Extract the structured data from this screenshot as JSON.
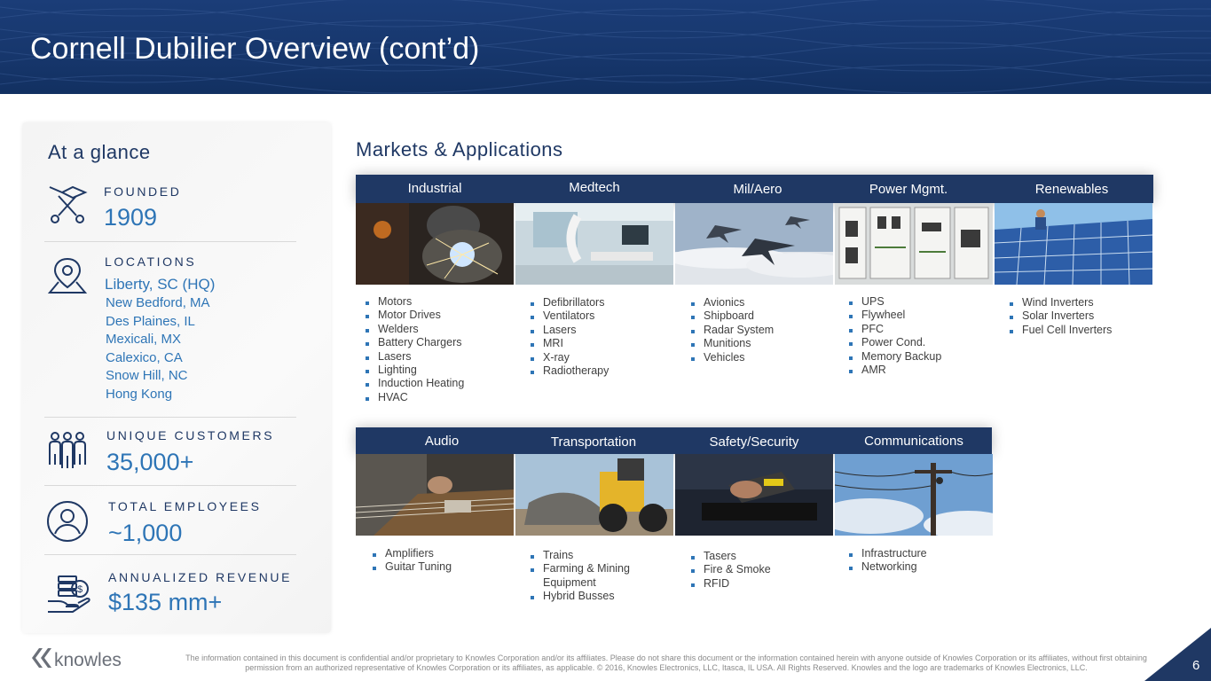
{
  "title": "Cornell Dubilier Overview (cont’d)",
  "glance": {
    "title": "At a glance",
    "founded_label": "FOUNDED",
    "founded_value": "1909",
    "locations_label": "LOCATIONS",
    "locations_hq": "Liberty, SC (HQ)",
    "locations": [
      "New Bedford, MA",
      "Des Plaines, IL",
      "Mexicali, MX",
      "Calexico, CA",
      "Snow Hill, NC",
      "Hong Kong"
    ],
    "customers_label": "UNIQUE CUSTOMERS",
    "customers_value": "35,000+",
    "employees_label": "TOTAL EMPLOYEES",
    "employees_value": "~1,000",
    "revenue_label": "ANNUALIZED REVENUE",
    "revenue_value": "$135 mm+"
  },
  "markets": {
    "title": "Markets & Applications",
    "row1": [
      {
        "name": "Industrial",
        "apps": [
          "Motors",
          "Motor Drives",
          "Welders",
          "Battery Chargers",
          "Lasers",
          "Lighting",
          "Induction Heating",
          "HVAC"
        ],
        "image": "welding-photo"
      },
      {
        "name": "Medtech",
        "apps": [
          "Defibrillators",
          "Ventilators",
          "Lasers",
          "MRI",
          "X-ray",
          "Radiotherapy"
        ],
        "image": "operating-room-photo"
      },
      {
        "name": "Mil/Aero",
        "apps": [
          "Avionics",
          "Shipboard",
          "Radar System",
          "Munitions",
          "Vehicles"
        ],
        "image": "fighter-jets-photo"
      },
      {
        "name": "Power Mgmt.",
        "apps": [
          "UPS",
          "Flywheel",
          "PFC",
          "Power Cond.",
          "Memory Backup",
          "AMR"
        ],
        "image": "electrical-panel-photo"
      },
      {
        "name": "Renewables",
        "apps": [
          "Wind Inverters",
          "Solar Inverters",
          "Fuel Cell Inverters"
        ],
        "image": "solar-panels-photo"
      }
    ],
    "row2": [
      {
        "name": "Audio",
        "apps": [
          "Amplifiers",
          "Guitar Tuning"
        ],
        "image": "guitar-photo"
      },
      {
        "name": "Transportation",
        "apps": [
          "Trains",
          "Farming & Mining Equipment",
          "Hybrid Busses"
        ],
        "image": "wheel-loader-photo"
      },
      {
        "name": "Safety/Security",
        "apps": [
          "Tasers",
          "Fire & Smoke",
          "RFID"
        ],
        "image": "taser-photo"
      },
      {
        "name": "Communications",
        "apps": [
          "Infrastructure",
          "Networking"
        ],
        "image": "utility-pole-photo"
      }
    ]
  },
  "footer": {
    "logo_text": "knowles",
    "disclaimer": "The information contained in this document is confidential and/or proprietary to Knowles Corporation and/or its affiliates. Please do not share this document or the information contained herein with anyone outside of Knowles Corporation or its affiliates, without first obtaining permission from an authorized representative of Knowles Corporation or its affiliates, as applicable. © 2016, Knowles Electronics, LLC, Itasca, IL USA. All Rights Reserved. Knowles and the logo are trademarks of Knowles Electronics, LLC.",
    "page_number": "6"
  },
  "colors": {
    "navy": "#1f3864",
    "accent": "#2e75b6",
    "header": "#17376d"
  }
}
